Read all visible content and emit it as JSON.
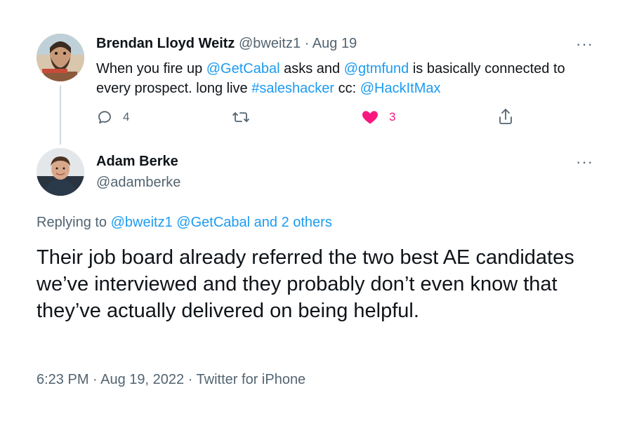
{
  "parent_tweet": {
    "author_name": "Brendan Lloyd Weitz",
    "handle": "@bweitz1",
    "separator": "·",
    "date": "Aug 19",
    "text": {
      "part1": "When you fire up ",
      "mention1": "@GetCabal",
      "part2": " asks and ",
      "mention2": "@gtmfund",
      "part3": " is basically connected to every prospect.  long live ",
      "hashtag": "#saleshacker",
      "part4": " cc: ",
      "mention3": "@HackItMax"
    },
    "more_label": "···",
    "actions": {
      "replies": "4",
      "retweets": "",
      "likes": "3",
      "share": ""
    },
    "like_color": "#f91880"
  },
  "reply_tweet": {
    "author_name": "Adam Berke",
    "handle": "@adamberke",
    "more_label": "···",
    "replying_prefix": "Replying to ",
    "replying_to": "@bweitz1 @GetCabal and 2 others",
    "text": "Their job board already referred the two best AE candidates we’ve interviewed and they probably don’t even know that they’ve actually delivered on being helpful.",
    "meta": "6:23 PM · Aug 19, 2022 · Twitter for iPhone"
  },
  "colors": {
    "accent": "#1d9bf0",
    "muted": "#536471",
    "thread_line": "#cfd9de"
  },
  "icons": [
    "reply-icon",
    "retweet-icon",
    "heart-icon",
    "share-icon",
    "more-icon"
  ]
}
